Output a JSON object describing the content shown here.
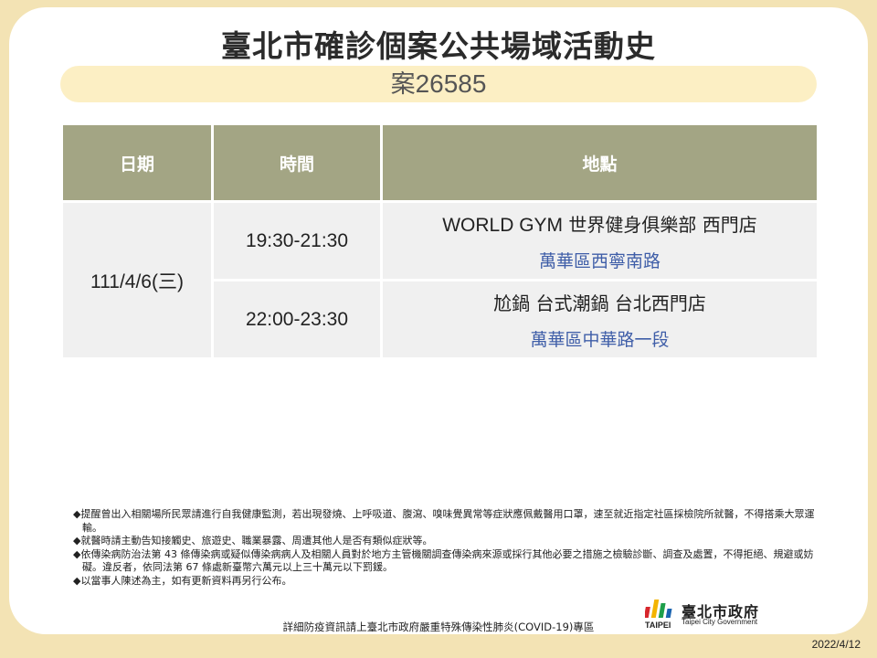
{
  "title": "臺北市確診個案公共場域活動史",
  "case": {
    "prefix": "案",
    "number": "26585"
  },
  "table": {
    "headers": [
      "日期",
      "時間",
      "地點"
    ],
    "date": "111/4/6(三)",
    "rows": [
      {
        "time": "19:30-21:30",
        "place_latin": "WORLD GYM",
        "place_rest": " 世界健身俱樂部 西門店",
        "address": "萬華區西寧南路"
      },
      {
        "time": "22:00-23:30",
        "place_latin": "",
        "place_rest": "尬鍋 台式潮鍋 台北西門店",
        "address": "萬華區中華路一段"
      }
    ]
  },
  "notes": [
    "◆提醒曾出入相關場所民眾請進行自我健康監測，若出現發燒、上呼吸道、腹瀉、嗅味覺異常等症狀應佩戴醫用口罩，速至就近指定社區採檢院所就醫，不得搭乘大眾運輸。",
    "◆就醫時請主動告知接觸史、旅遊史、職業暴露、周遭其他人是否有類似症狀等。",
    "◆依傳染病防治法第 43 條傳染病或疑似傳染病病人及相關人員對於地方主管機關調查傳染病來源或採行其他必要之措施之檢驗診斷、調查及處置，不得拒絕、規避或妨礙。違反者，依同法第 67 條處新臺幣六萬元以上三十萬元以下罰鍰。",
    "◆以當事人陳述為主，如有更新資料再另行公布。"
  ],
  "footer": "詳細防疫資訊請上臺北市政府嚴重特殊傳染性肺炎(COVID-19)專區",
  "logo": {
    "name_cn": "臺北市政府",
    "name_en": "Taipei City Government",
    "wordmark": "TAIPEI",
    "icon": "taipei-city-logo-icon",
    "colors": [
      "#d7262c",
      "#f3b400",
      "#1e9f4b",
      "#1b64b0"
    ]
  },
  "date": "2022/4/12",
  "colors": {
    "background": "#f3e3b4",
    "header": "#a3a584",
    "cell": "#f0f0f0",
    "case_bar": "#fcefc4",
    "address": "#3f5ea8"
  }
}
